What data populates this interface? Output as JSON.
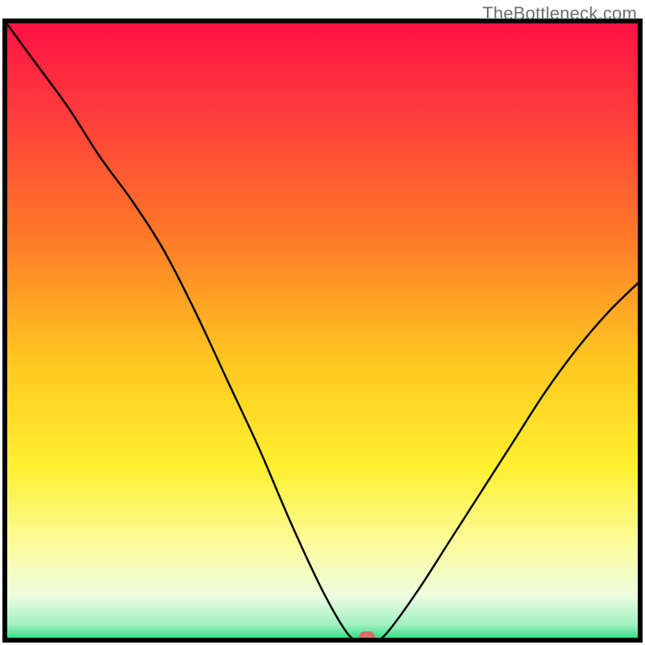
{
  "watermark": "TheBottleneck.com",
  "chart_data": {
    "type": "line",
    "title": "",
    "xlabel": "",
    "ylabel": "",
    "xlim": [
      0,
      100
    ],
    "ylim": [
      0,
      100
    ],
    "x": [
      0,
      5,
      10,
      15,
      20,
      25,
      30,
      35,
      40,
      45,
      50,
      54,
      56,
      58,
      60,
      65,
      70,
      75,
      80,
      85,
      90,
      95,
      100
    ],
    "values": [
      100,
      93,
      86,
      78,
      71,
      63,
      53,
      42,
      31,
      19,
      8,
      1,
      0,
      0,
      1,
      8,
      16,
      24,
      32,
      40,
      47,
      53,
      58
    ],
    "marker": {
      "x": 57,
      "y": 0.5
    },
    "background": {
      "type": "vertical-gradient",
      "stops": [
        {
          "offset": 0.0,
          "color": "#ff1144"
        },
        {
          "offset": 0.15,
          "color": "#ff3c3c"
        },
        {
          "offset": 0.35,
          "color": "#ff7a28"
        },
        {
          "offset": 0.55,
          "color": "#ffc820"
        },
        {
          "offset": 0.72,
          "color": "#fff030"
        },
        {
          "offset": 0.85,
          "color": "#fbfca0"
        },
        {
          "offset": 0.93,
          "color": "#ecfce0"
        },
        {
          "offset": 0.975,
          "color": "#a0f0c0"
        },
        {
          "offset": 1.0,
          "color": "#1ee080"
        }
      ]
    },
    "border_color": "#000000",
    "curve_color": "#000000",
    "marker_color": "#d96b6b"
  }
}
